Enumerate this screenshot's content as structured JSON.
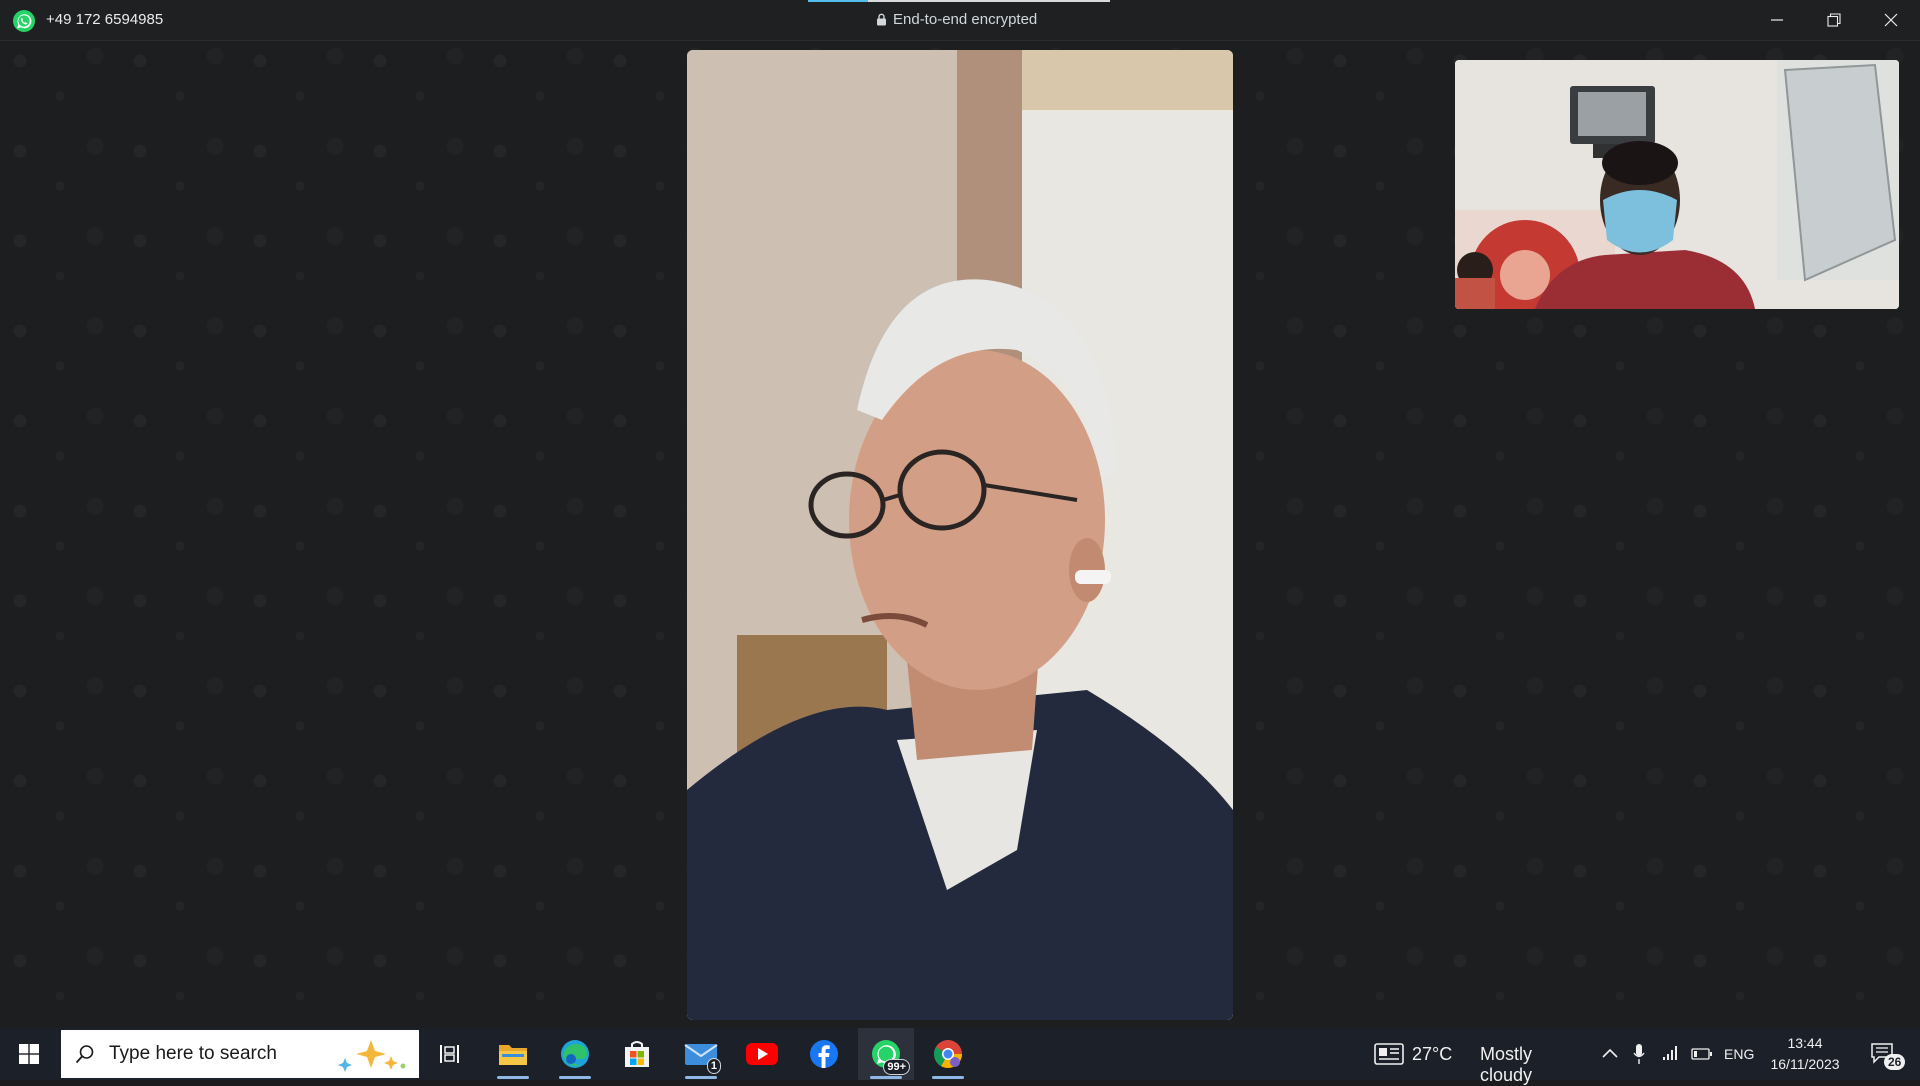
{
  "titlebar": {
    "caller_number": "+49 172 6594985",
    "encryption_label": "End-to-end encrypted",
    "controls": [
      "minimize-icon",
      "restore-icon",
      "close-icon"
    ]
  },
  "call": {
    "remote_video": "remote-participant-video",
    "self_video": "self-preview-video"
  },
  "taskbar": {
    "search_placeholder": "Type here to search",
    "pinned_apps": [
      "task-view-icon",
      "file-explorer-icon",
      "edge-icon",
      "microsoft-store-icon",
      "mail-icon",
      "youtube-icon",
      "facebook-icon",
      "whatsapp-icon",
      "chrome-icon"
    ],
    "mail_badge": "1",
    "whatsapp_badge": "99+",
    "weather": {
      "temperature": "27°C",
      "condition": "Mostly cloudy"
    },
    "language": "ENG",
    "time": "13:44",
    "date": "16/11/2023",
    "notifications_count": "26"
  },
  "colors": {
    "accent": "#53bdeb",
    "whatsapp_green": "#25d366",
    "taskbar_bg": "#1c2029",
    "call_bg": "#1d1e1f"
  }
}
